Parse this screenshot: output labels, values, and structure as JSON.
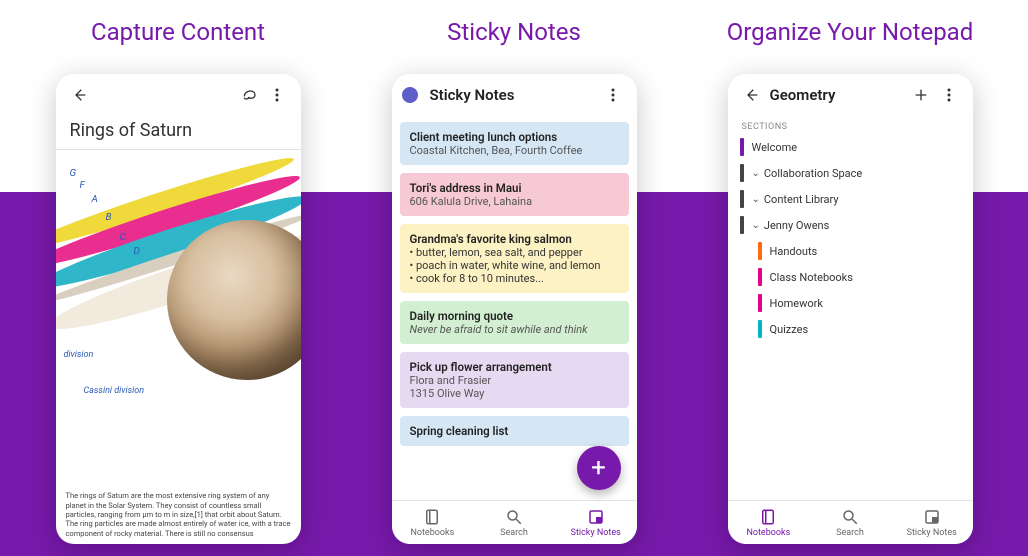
{
  "panel1": {
    "title": "Capture Content",
    "noteTitle": "Rings of Saturn",
    "ringLabels": [
      "G",
      "F",
      "A",
      "B",
      "C",
      "D"
    ],
    "annotations": {
      "division": "division",
      "cassini": "Cassini division"
    },
    "caption": "The rings of Saturn are the most extensive ring system of any planet in the Solar System. They consist of countless small particles, ranging from μm to m in size,[1] that orbit about Saturn. The ring particles are made almost entirely of water ice, with a trace component of rocky material. There is still no consensus"
  },
  "panel2": {
    "title": "Sticky Notes",
    "appbarTitle": "Sticky Notes",
    "notes": [
      {
        "bg": "#d5e6f5",
        "head": "Client meeting lunch options",
        "sub": "Coastal Kitchen, Bea, Fourth Coffee"
      },
      {
        "bg": "#f7c9d4",
        "head": "Tori's address in Maui",
        "sub": "606 Kalula Drive, Lahaina"
      },
      {
        "bg": "#fdf2c4",
        "head": "Grandma's favorite king salmon",
        "bullets": [
          "butter, lemon, sea salt, and pepper",
          "poach in water, white wine, and lemon",
          "cook for 8 to 10 minutes..."
        ]
      },
      {
        "bg": "#d2efd2",
        "head": "Daily morning quote",
        "italic": "Never be afraid to sit awhile and think"
      },
      {
        "bg": "#e6d9f2",
        "head": "Pick up flower arrangement",
        "sub": "Flora and Frasier\n1315 Olive Way"
      },
      {
        "bg": "#d5e6f5",
        "head": "Spring cleaning list"
      }
    ],
    "bottomNav": {
      "notebooks": "Notebooks",
      "search": "Search",
      "sticky": "Sticky Notes",
      "activeIndex": 2
    }
  },
  "panel3": {
    "title": "Organize Your Notepad",
    "appbarTitle": "Geometry",
    "sectionsLabel": "SECTIONS",
    "sections": [
      {
        "color": "#7719aa",
        "label": "Welcome",
        "chev": false
      },
      {
        "color": "#444",
        "label": "Collaboration Space",
        "chev": true
      },
      {
        "color": "#444",
        "label": "Content Library",
        "chev": true
      },
      {
        "color": "#444",
        "label": "Jenny Owens",
        "chev": true
      }
    ],
    "subsections": [
      {
        "color": "#ff6a13",
        "label": "Handouts"
      },
      {
        "color": "#e3008c",
        "label": "Class Notebooks"
      },
      {
        "color": "#e3008c",
        "label": "Homework"
      },
      {
        "color": "#00b7c3",
        "label": "Quizzes"
      }
    ],
    "bottomNav": {
      "notebooks": "Notebooks",
      "search": "Search",
      "sticky": "Sticky Notes",
      "activeIndex": 0
    }
  }
}
